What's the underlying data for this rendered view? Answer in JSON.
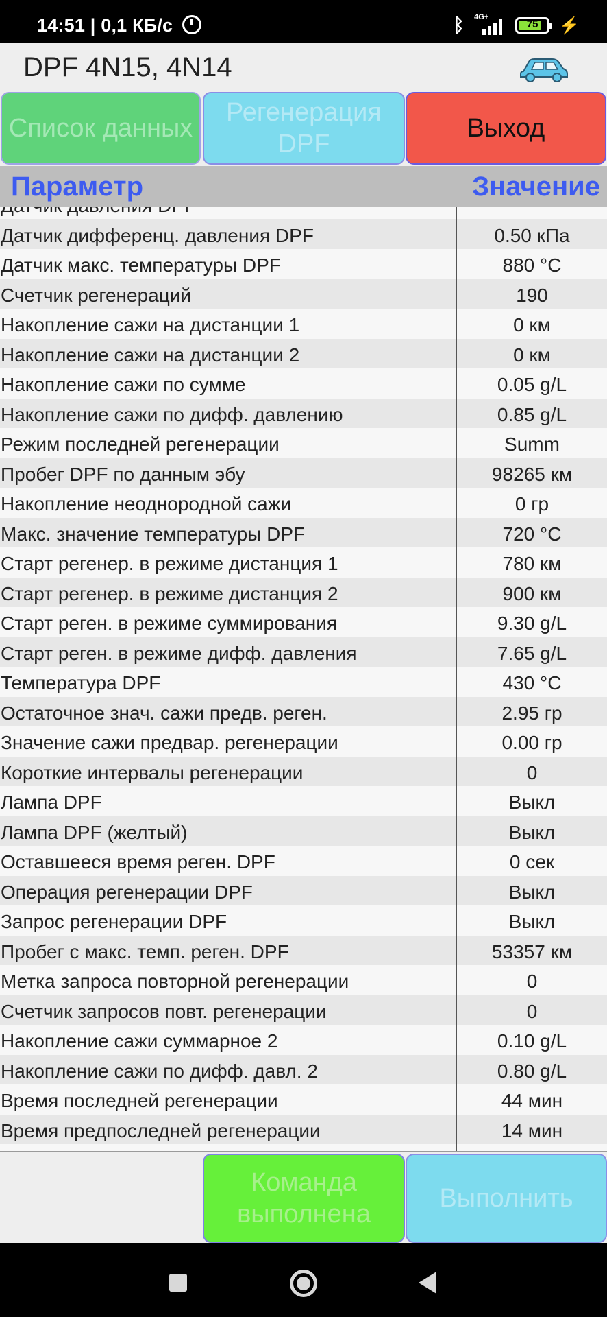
{
  "status_bar": {
    "time": "14:51",
    "speed": "0,1 КБ/с",
    "network": "4G+",
    "battery": "75"
  },
  "header": {
    "title": "DPF 4N15, 4N14"
  },
  "buttons": {
    "data_list": "Список данных",
    "regen_dpf": "Регенерация DPF",
    "exit": "Выход",
    "command_done": "Команда выполнена",
    "execute": "Выполнить"
  },
  "table": {
    "col_param": "Параметр",
    "col_value": "Значение",
    "rows": [
      {
        "name": "Датчик давления DPF",
        "value": ""
      },
      {
        "name": "Датчик дифференц. давления DPF",
        "value": "0.50  кПа"
      },
      {
        "name": "Датчик макс. температуры DPF",
        "value": "880  °C"
      },
      {
        "name": "Счетчик регенераций",
        "value": "190"
      },
      {
        "name": "Накопление сажи на дистанции 1",
        "value": "0  км"
      },
      {
        "name": "Накопление сажи на дистанции 2",
        "value": "0  км"
      },
      {
        "name": "Накопление сажи по сумме",
        "value": "0.05  g/L"
      },
      {
        "name": "Накопление сажи по дифф. давлению",
        "value": "0.85  g/L"
      },
      {
        "name": "Режим последней регенерации",
        "value": "Summ"
      },
      {
        "name": "Пробег DPF по данным эбу",
        "value": "98265  км"
      },
      {
        "name": "Накопление неоднородной сажи",
        "value": "0  гр"
      },
      {
        "name": "Макс. значение температуры DPF",
        "value": "720  °C"
      },
      {
        "name": "Старт регенер. в режиме дистанция 1",
        "value": "780  км"
      },
      {
        "name": "Старт регенер. в режиме дистанция 2",
        "value": "900  км"
      },
      {
        "name": "Старт реген. в режиме суммирования",
        "value": "9.30  g/L"
      },
      {
        "name": "Старт реген. в режиме дифф. давления",
        "value": "7.65  g/L"
      },
      {
        "name": "Температура DPF",
        "value": "430  °C"
      },
      {
        "name": "Остаточное знач. сажи предв. реген.",
        "value": "2.95  гр"
      },
      {
        "name": "Значение сажи предвар. регенерации",
        "value": "0.00  гр"
      },
      {
        "name": "Короткие интервалы регенерации",
        "value": "0"
      },
      {
        "name": "Лампа DPF",
        "value": "Выкл"
      },
      {
        "name": "Лампа DPF (желтый)",
        "value": "Выкл"
      },
      {
        "name": "Оставшееся время реген. DPF",
        "value": "0  сек"
      },
      {
        "name": "Операция регенерации DPF",
        "value": "Выкл"
      },
      {
        "name": "Запрос регенерации DPF",
        "value": "Выкл"
      },
      {
        "name": "Пробег с макс. темп. реген. DPF",
        "value": "53357  км"
      },
      {
        "name": "Метка запроса повторной регенерации",
        "value": "0"
      },
      {
        "name": "Счетчик запросов повт. регенерации",
        "value": "0"
      },
      {
        "name": "Накопление сажи суммарное 2",
        "value": "0.10  g/L"
      },
      {
        "name": "Накопление сажи по дифф. давл. 2",
        "value": "0.80  g/L"
      },
      {
        "name": "Время последней регенерации",
        "value": "44  мин"
      },
      {
        "name": "Время предпоследней регенерации",
        "value": "14  мин"
      }
    ]
  },
  "colors": {
    "accent_blue": "#3d5bf0",
    "green_button": "#5fd37a",
    "cyan_button": "#7ddbee",
    "red_button": "#f2574a",
    "bright_green_button": "#66f03a"
  }
}
